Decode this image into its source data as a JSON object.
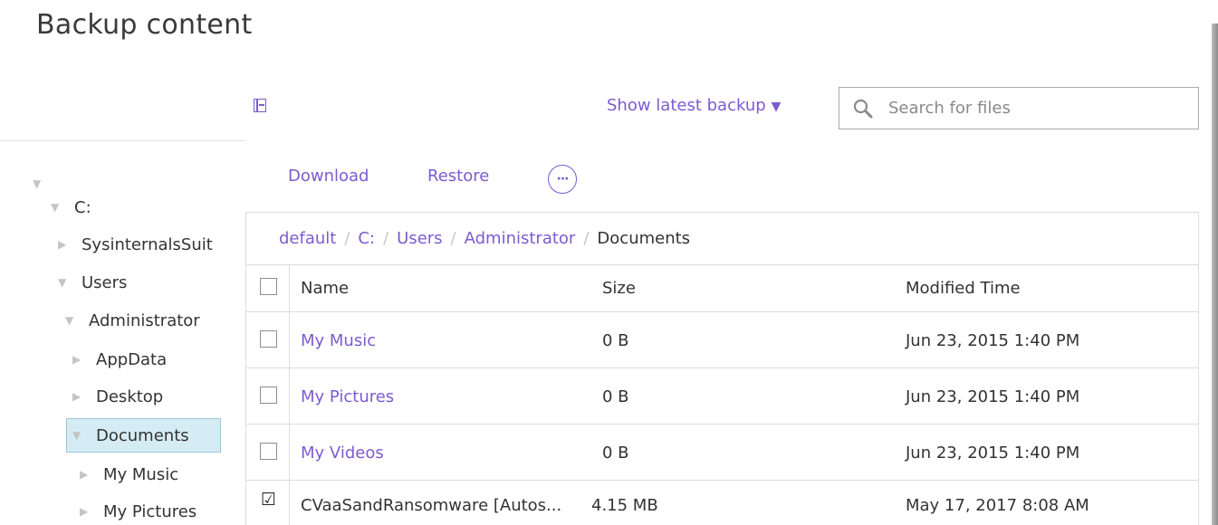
{
  "title": "Backup content",
  "tree": {
    "root_label": "",
    "items": [
      {
        "label": "C:",
        "state": "expanded"
      },
      {
        "label": "SysinternalsSuit",
        "state": "collapsed"
      },
      {
        "label": "Users",
        "state": "expanded"
      },
      {
        "label": "Administrator",
        "state": "expanded"
      },
      {
        "label": "AppData",
        "state": "collapsed"
      },
      {
        "label": "Desktop",
        "state": "collapsed"
      },
      {
        "label": "Documents",
        "state": "expanded",
        "selected": true
      },
      {
        "label": "My Music",
        "state": "collapsed"
      },
      {
        "label": "My Pictures",
        "state": "collapsed"
      }
    ]
  },
  "controls": {
    "collapse_icon": "sidebar-collapse-icon",
    "show_latest_label": "Show latest backup",
    "caret": "▼",
    "search_placeholder": "Search for files"
  },
  "toolbar": {
    "download_label": "Download",
    "restore_label": "Restore",
    "more_icon": "···"
  },
  "breadcrumb": {
    "items": [
      "default",
      "C:",
      "Users",
      "Administrator"
    ],
    "separator": "/",
    "current": "Documents"
  },
  "table": {
    "columns": [
      "Name",
      "Size",
      "Modified Time"
    ],
    "rows": [
      {
        "name": "My Music",
        "size": "0 B",
        "modified": "Jun 23, 2015 1:40 PM",
        "checked": false,
        "is_link": true
      },
      {
        "name": "My Pictures",
        "size": "0 B",
        "modified": "Jun 23, 2015 1:40 PM",
        "checked": false,
        "is_link": true
      },
      {
        "name": "My Videos",
        "size": "0 B",
        "modified": "Jun 23, 2015 1:40 PM",
        "checked": false,
        "is_link": true
      },
      {
        "name": "CVaaSandRansomware [Autos...",
        "size": "4.15 MB",
        "modified": "May 17, 2017 8:08 AM",
        "checked": true,
        "is_link": false
      }
    ]
  },
  "colors": {
    "accent": "#7c5bd0",
    "selected_bg": "#d6ecf5"
  }
}
